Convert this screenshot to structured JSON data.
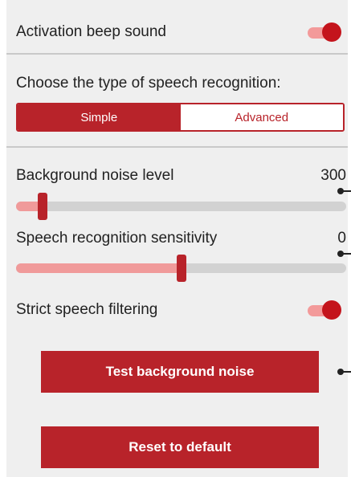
{
  "settings": {
    "activation_beep": {
      "label": "Activation beep sound",
      "enabled": true
    },
    "recognition_type": {
      "heading": "Choose the type of speech recognition:",
      "options": [
        "Simple",
        "Advanced"
      ],
      "selected": "Simple"
    },
    "background_noise": {
      "label": "Background noise level",
      "value": "300",
      "level": 0.08
    },
    "sensitivity": {
      "label": "Speech recognition sensitivity",
      "value": "0",
      "level": 0.5
    },
    "strict_filtering": {
      "label": "Strict speech filtering",
      "enabled": true
    }
  },
  "buttons": {
    "test_noise": "Test background noise",
    "reset_default": "Reset to default"
  },
  "colors": {
    "accent": "#b8232a",
    "accent_light": "#f09a9a",
    "panel_bg": "#efefef"
  }
}
